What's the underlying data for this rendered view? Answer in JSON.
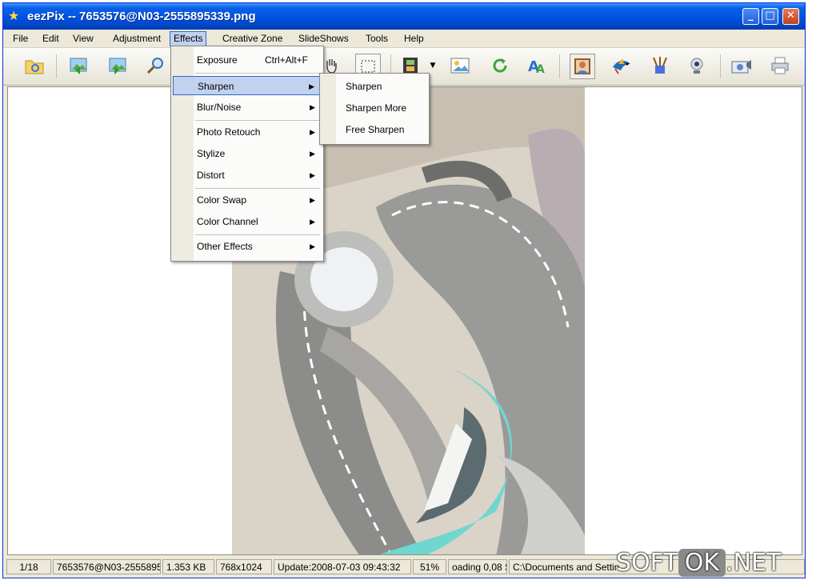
{
  "window": {
    "title": "eezPix -- 7653576@N03-2555895339.png",
    "controls": {
      "minimize": "_",
      "maximize": "□",
      "close": "✕"
    }
  },
  "menubar": {
    "items": [
      "File",
      "Edit",
      "View",
      "Adjustment",
      "Effects",
      "Creative Zone",
      "SlideShows",
      "Tools",
      "Help"
    ],
    "active": "Effects"
  },
  "toolbar": {
    "icons": [
      "open-folder-icon",
      "previous-image-icon",
      "next-image-icon",
      "zoom-icon",
      "hand-tool-icon",
      "select-rectangle-icon",
      "filmstrip-icon",
      "dropdown-arrow-icon",
      "picture-icon",
      "rotate-icon",
      "text-icon",
      "portrait-frame-icon",
      "bird-icon",
      "paint-brush-icon",
      "webcam-icon",
      "camera-icon",
      "printer-icon"
    ]
  },
  "effects_menu": {
    "items": [
      {
        "label": "Exposure",
        "shortcut": "Ctrl+Alt+F",
        "submenu": false
      },
      {
        "label": "Sharpen",
        "shortcut": "",
        "submenu": true,
        "highlighted": true
      },
      {
        "label": "Blur/Noise",
        "shortcut": "",
        "submenu": true
      },
      {
        "label": "Photo Retouch",
        "shortcut": "",
        "submenu": true
      },
      {
        "label": "Stylize",
        "shortcut": "",
        "submenu": true
      },
      {
        "label": "Distort",
        "shortcut": "",
        "submenu": true
      },
      {
        "label": "Color Swap",
        "shortcut": "",
        "submenu": true
      },
      {
        "label": "Color Channel",
        "shortcut": "",
        "submenu": true
      },
      {
        "label": "Other Effects",
        "shortcut": "",
        "submenu": true
      }
    ],
    "arrow": "▶"
  },
  "sharpen_submenu": {
    "items": [
      "Sharpen",
      "Sharpen More",
      "Free Sharpen"
    ]
  },
  "statusbar": {
    "index": "1/18",
    "filename": "7653576@N03-2555895",
    "filesize": "1.353 KB",
    "dimensions": "768x1024",
    "updated": "Update:2008-07-03 09:43:32",
    "zoom": "51%",
    "loading": "oading 0,08 Se",
    "path": "C:\\Documents and Settin"
  },
  "watermark": {
    "left": "SOFT",
    "middle": "OK",
    "right": ".NET"
  },
  "colors": {
    "titlebar": "#0055e5",
    "highlight": "#c1d2ee",
    "highlight_border": "#316ac5",
    "teal_accent": "#6fd6d0"
  }
}
